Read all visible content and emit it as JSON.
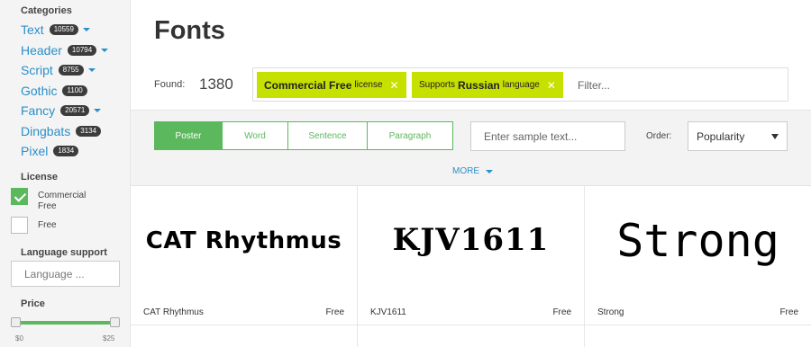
{
  "sidebar": {
    "categories_title": "Categories",
    "categories": [
      {
        "label": "Text",
        "count": "10559",
        "expandable": true
      },
      {
        "label": "Header",
        "count": "10794",
        "expandable": true
      },
      {
        "label": "Script",
        "count": "8755",
        "expandable": true
      },
      {
        "label": "Gothic",
        "count": "1100",
        "expandable": false
      },
      {
        "label": "Fancy",
        "count": "20571",
        "expandable": true
      },
      {
        "label": "Dingbats",
        "count": "3134",
        "expandable": false
      },
      {
        "label": "Pixel",
        "count": "1834",
        "expandable": false
      }
    ],
    "license_title": "License",
    "license_options": [
      {
        "label": "Commercial Free",
        "checked": true
      },
      {
        "label": "Free",
        "checked": false
      }
    ],
    "language_title": "Language support",
    "language_placeholder": "Language ...",
    "price_title": "Price",
    "price_min": "$0",
    "price_max": "$25"
  },
  "main": {
    "title": "Fonts",
    "found_label": "Found:",
    "found_count": "1380",
    "filters": [
      {
        "bold": "Commercial Free",
        "rest": "license"
      },
      {
        "bold": "Russian",
        "prefix": "Supports",
        "rest": "language"
      }
    ],
    "filter_placeholder": "Filter...",
    "modes": [
      "Poster",
      "Word",
      "Sentence",
      "Paragraph"
    ],
    "active_mode": "Poster",
    "sample_placeholder": "Enter sample text...",
    "order_label": "Order:",
    "order_value": "Popularity",
    "more_label": "MORE",
    "fonts": [
      {
        "name": "CAT Rhythmus",
        "price": "Free",
        "preview": "CAT Rhythmus"
      },
      {
        "name": "KJV1611",
        "price": "Free",
        "preview": "KJV1611"
      },
      {
        "name": "Strong",
        "price": "Free",
        "preview": "Strong"
      }
    ]
  },
  "colors": {
    "accent_green": "#5cb85c",
    "chip_yellow": "#c6e000",
    "link_blue": "#2a8fc9",
    "badge_dark": "#3c3c3c"
  }
}
